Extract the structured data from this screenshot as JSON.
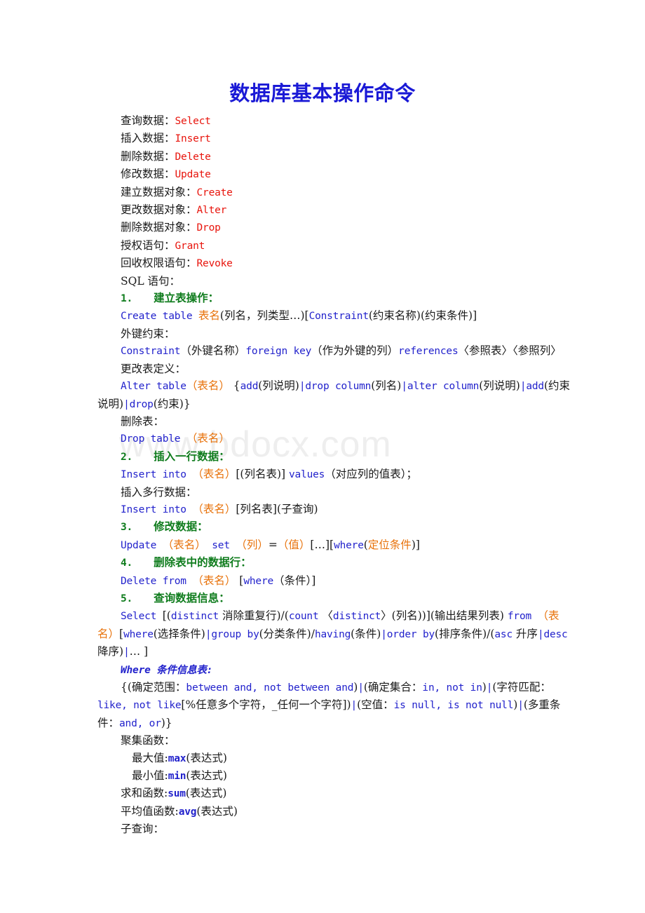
{
  "document": {
    "title": "数据库基本操作命令",
    "title_color": "#1a19d6",
    "watermark": "www.bdocx.com",
    "watermark_color": "#eeeeee"
  },
  "palette": {
    "command_red": "#e8140c",
    "keyword_blue": "#2222cc",
    "heading_green": "#0f7c1d",
    "placeholder_orange": "#e8730c",
    "body_black": "#1a1a1a"
  },
  "commands": [
    {
      "label": "查询数据：",
      "value": "Select"
    },
    {
      "label": "插入数据：",
      "value": "Insert"
    },
    {
      "label": "删除数据：",
      "value": "Delete"
    },
    {
      "label": "修改数据：",
      "value": "Update"
    },
    {
      "label": "建立数据对象：",
      "value": "Create"
    },
    {
      "label": "更改数据对象：",
      "value": "Alter"
    },
    {
      "label": "删除数据对象：",
      "value": "Drop"
    },
    {
      "label": "授权语句：",
      "value": "Grant"
    },
    {
      "label": "回收权限语句：",
      "value": "Revoke"
    }
  ],
  "sql_section_label": "SQL 语句：",
  "sections": [
    {
      "number": "1.",
      "heading": "建立表操作：",
      "create_table": {
        "kw1": "Create table ",
        "ph1": "表名",
        "plain1": "(列名，列类型…)[",
        "kw2": "Constraint",
        "plain2": "(约束名称)(约束条件)]"
      },
      "fk_label": "外键约束：",
      "fk_line": {
        "kw1": "Constraint",
        "plain1": "（外键名称）",
        "kw2": "foreign key",
        "plain2": "（作为外键的列）",
        "kw3": "references",
        "plain3": "〈参照表〉〈参照列〉"
      },
      "alter_label": "更改表定义：",
      "alter_line": {
        "kw1": "Alter table",
        "ph1": "（表名）",
        "plain1": " {",
        "kw2": "add",
        "plain2": "(列说明)",
        "bar1": "|",
        "kw3": "drop column",
        "plain3": "(列名)",
        "bar2": "|",
        "kw4": "alter column",
        "plain4": "(列说明)",
        "bar3": "|",
        "kw5": "add",
        "plain5": "(约束说明)",
        "bar4": "|",
        "kw6": "drop",
        "plain6": "(约束)}"
      },
      "drop_label": "删除表：",
      "drop_line": {
        "kw1": "Drop table ",
        "ph1": "（表名）"
      }
    },
    {
      "number": "2.",
      "heading": "插入一行数据：",
      "insert_one": {
        "kw1": "Insert into ",
        "ph1": "（表名）",
        "plain1": "[(列名表)] ",
        "kw2": "values",
        "plain2": "（对应列的值表）；"
      },
      "multi_label": "插入多行数据：",
      "insert_multi": {
        "kw1": "Insert into ",
        "ph1": "（表名）",
        "plain1": "[列名表](子查询)"
      }
    },
    {
      "number": "3.",
      "heading": "修改数据：",
      "update_line": {
        "kw1": "Update ",
        "ph1": "（表名）",
        "kw2": " set ",
        "ph2": "（列）",
        "plain1": "=",
        "ph3": "（值）",
        "plain2": "[…][",
        "kw3": "where",
        "plain3": "(",
        "ph4": "定位条件",
        "plain4": ")]"
      }
    },
    {
      "number": "4.",
      "heading": "删除表中的数据行：",
      "delete_line": {
        "kw1": "Delete from ",
        "ph1": "（表名）",
        "plain1": " [",
        "kw2": "where",
        "plain2": "（条件）]"
      }
    },
    {
      "number": "5.",
      "heading": "查询数据信息：",
      "select_line": {
        "kw1": "Select ",
        "plain1": "[(",
        "kw2": "distinct",
        "plain2": " 消除重复行)/(",
        "kw3": "count",
        "plain3": " 〈",
        "kw4": "distinct",
        "plain4": "〉(列名))](输出结果列表) ",
        "kw5": "from ",
        "ph1": "（表名）",
        "plain5": "[",
        "kw6": "where",
        "plain6": "(选择条件)",
        "bar1": "|",
        "kw7": "group by",
        "plain7": "(分类条件)/",
        "kw8": "having",
        "plain8": "(条件)",
        "bar2": "|",
        "kw9": "order by",
        "plain9": "(排序条件)/(",
        "kw10": "asc",
        "plain10": " 升序",
        "bar3": "|",
        "kw11": "desc",
        "plain11": " 降序)",
        "bar4": "|",
        "plain12": "… ]"
      }
    }
  ],
  "where_table": {
    "heading": "Where 条件信息表:",
    "content": {
      "p1": "{(确定范围：",
      "k1": "between and, not between and",
      "p2": ")",
      "b1": "|",
      "p3": "(确定集合：",
      "k2": "in, not in",
      "p4": ")",
      "b2": "|",
      "p5": "(字符匹配：",
      "k3": "like, not like",
      "p6": "[%任意多个字符，_任何一个字符])",
      "b3": "|",
      "p7": "(空值：",
      "k4": "is null, is not null",
      "p8": ")",
      "b4": "|",
      "p9": "(多重条件：",
      "k5": "and, or",
      "p10": ")}"
    }
  },
  "aggregates": {
    "label": "聚集函数：",
    "items": [
      {
        "label": "最大值:",
        "fn": "max",
        "arg": "(表达式)",
        "indent": "deep"
      },
      {
        "label": "最小值:",
        "fn": "min",
        "arg": "(表达式)",
        "indent": "deep"
      },
      {
        "label": "求和函数:",
        "fn": "sum",
        "arg": "(表达式)",
        "indent": "normal"
      },
      {
        "label": "平均值函数:",
        "fn": "avg",
        "arg": "(表达式)",
        "indent": "normal"
      }
    ]
  },
  "subquery_label": "子查询："
}
